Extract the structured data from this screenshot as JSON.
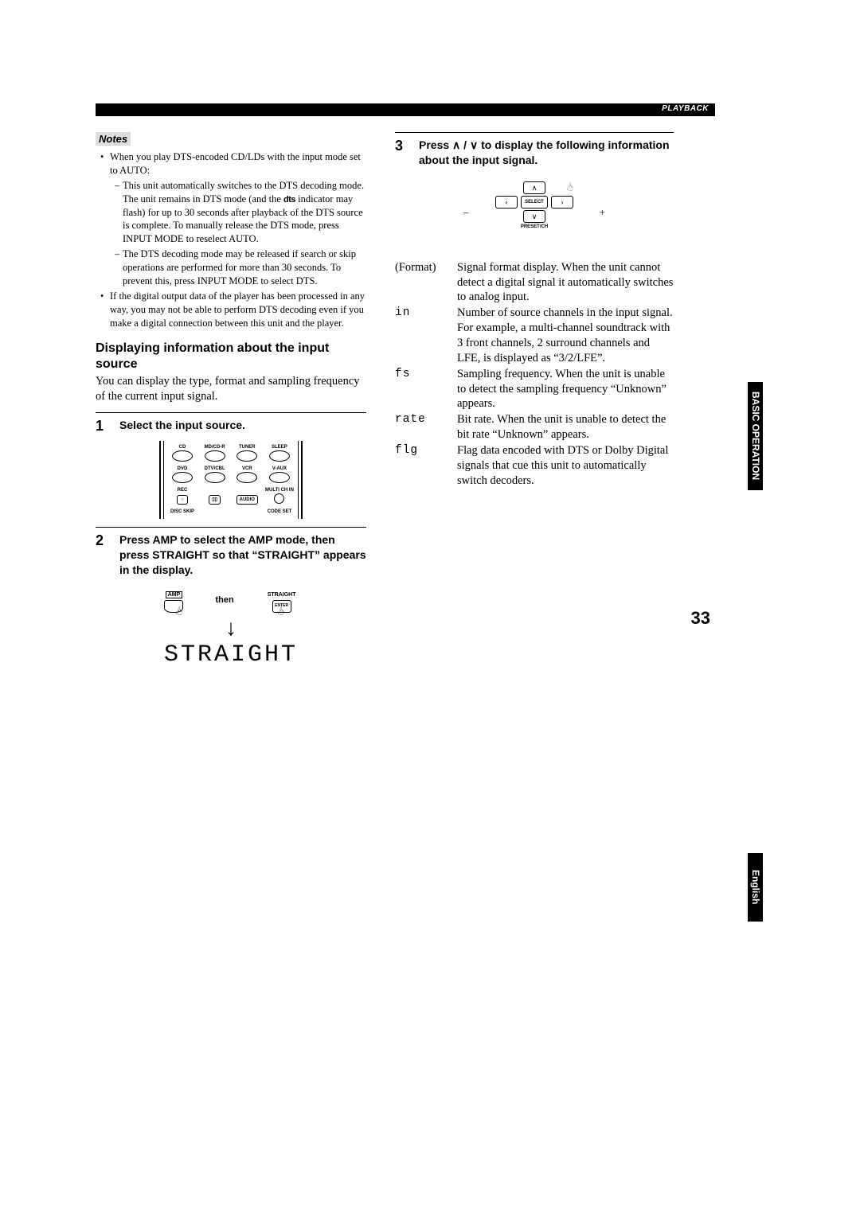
{
  "header": {
    "section_label": "PLAYBACK"
  },
  "notes": {
    "title": "Notes",
    "n1": "When you play DTS-encoded CD/LDs with the input mode set to AUTO:",
    "n1a": "This unit automatically switches to the DTS decoding mode. The unit remains in DTS mode (and the ",
    "n1a_after": " indicator may flash) for up to 30 seconds after playback of the DTS source is complete. To manually release the DTS mode, press INPUT MODE to reselect AUTO.",
    "dts_logo": "dts",
    "n1b": "The DTS decoding mode may be released if search or skip operations are performed for more than 30 seconds. To prevent this, press INPUT MODE to select DTS.",
    "n2": "If the digital output data of the player has been processed in any way, you may not be able to perform DTS decoding even if you make a digital connection between this unit and the player."
  },
  "section": {
    "heading": "Displaying information about the input source",
    "body": "You can display the type, format and sampling frequency of the current input signal."
  },
  "steps": {
    "s1_num": "1",
    "s1_text": "Select the input source.",
    "s2_num": "2",
    "s2_text": "Press AMP to select the AMP mode, then press STRAIGHT so that “STRAIGHT” appears in the display.",
    "s2_then": "then",
    "s2_display": "STRAIGHT",
    "s3_num": "3",
    "s3_text": "Press ∧ / ∨ to display the following information about the input signal."
  },
  "remote": {
    "row1": {
      "a": "CD",
      "b": "MD/CD-R",
      "c": "TUNER",
      "d": "SLEEP"
    },
    "row2": {
      "a": "DVD",
      "b": "DTV/CBL",
      "c": "VCR",
      "d": "V-AUX"
    },
    "row3": {
      "a": "REC",
      "d": "MULTI CH IN"
    },
    "row3_audio": "AUDIO",
    "row3_bottom_a": "DISC SKIP",
    "row3_bottom_d": "CODE SET",
    "amp_label": "AMP",
    "straight_label": "STRAIGHT",
    "straight_sub": "ENTER"
  },
  "dpad": {
    "minus": "–",
    "plus": "+",
    "up": "∧",
    "down": "∨",
    "left": "‹",
    "right": "›",
    "center": "SELECT",
    "bottom_label": "PRESET/CH"
  },
  "info": {
    "r1_key": "(Format)",
    "r1_val": "Signal format display. When the unit cannot detect a digital signal it automatically switches to analog input.",
    "r2_key": "in",
    "r2_val": "Number of source channels in the input signal. For example, a multi-channel soundtrack with 3 front channels, 2 surround channels and LFE, is displayed as “3/2/LFE”.",
    "r3_key": "fs",
    "r3_val": "Sampling frequency. When the unit is unable to detect the sampling frequency “Unknown” appears.",
    "r4_key": "rate",
    "r4_val": "Bit rate. When the unit is unable to detect the bit rate “Unknown” appears.",
    "r5_key": "flg",
    "r5_val": "Flag data encoded with DTS or Dolby Digital signals that cue this unit to automatically switch decoders."
  },
  "sidetabs": {
    "basic": "BASIC OPERATION",
    "english": "English"
  },
  "page_number": "33"
}
